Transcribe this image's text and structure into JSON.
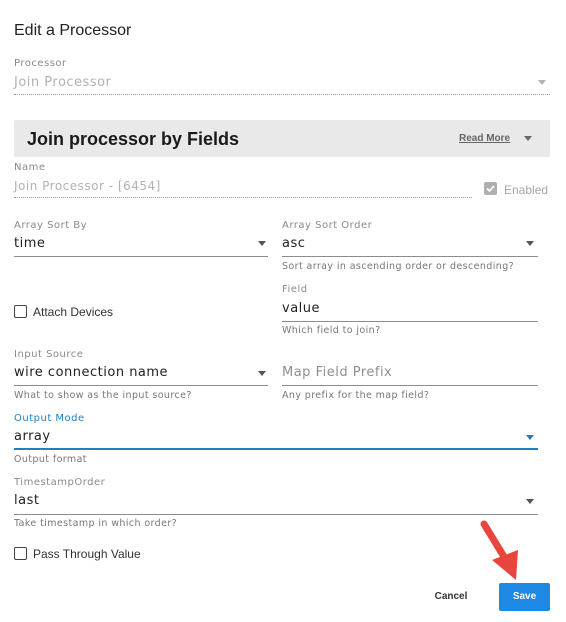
{
  "dialog": {
    "title": "Edit a Processor"
  },
  "processor": {
    "label": "Processor",
    "value": "Join Processor"
  },
  "banner": {
    "title": "Join processor by Fields",
    "read_more": "Read More"
  },
  "name_field": {
    "label": "Name",
    "value": "Join Processor  - [6454]"
  },
  "enabled": {
    "label": "Enabled",
    "checked": true
  },
  "array_sort_by": {
    "label": "Array Sort By",
    "value": "time"
  },
  "array_sort_order": {
    "label": "Array Sort Order",
    "value": "asc",
    "helper": "Sort array in ascending order or descending?"
  },
  "attach_devices": {
    "label": "Attach Devices",
    "checked": false
  },
  "field": {
    "label": "Field",
    "value": "value",
    "helper": "Which field to join?"
  },
  "input_source": {
    "label": "Input Source",
    "value": "wire connection name",
    "helper": "What to show as the input source?"
  },
  "map_field_prefix": {
    "placeholder": "Map Field Prefix",
    "helper": "Any prefix for the map field?"
  },
  "output_mode": {
    "label": "Output Mode",
    "value": "array",
    "helper": "Output format"
  },
  "timestamp_order": {
    "label": "TimestampOrder",
    "value": "last",
    "helper": "Take timestamp in which order?"
  },
  "pass_through": {
    "label": "Pass Through Value",
    "checked": false
  },
  "actions": {
    "cancel": "Cancel",
    "save": "Save"
  },
  "colors": {
    "accent": "#1e88e5",
    "annotation_arrow": "#e8453c",
    "active_field": "#1e7fc9"
  }
}
